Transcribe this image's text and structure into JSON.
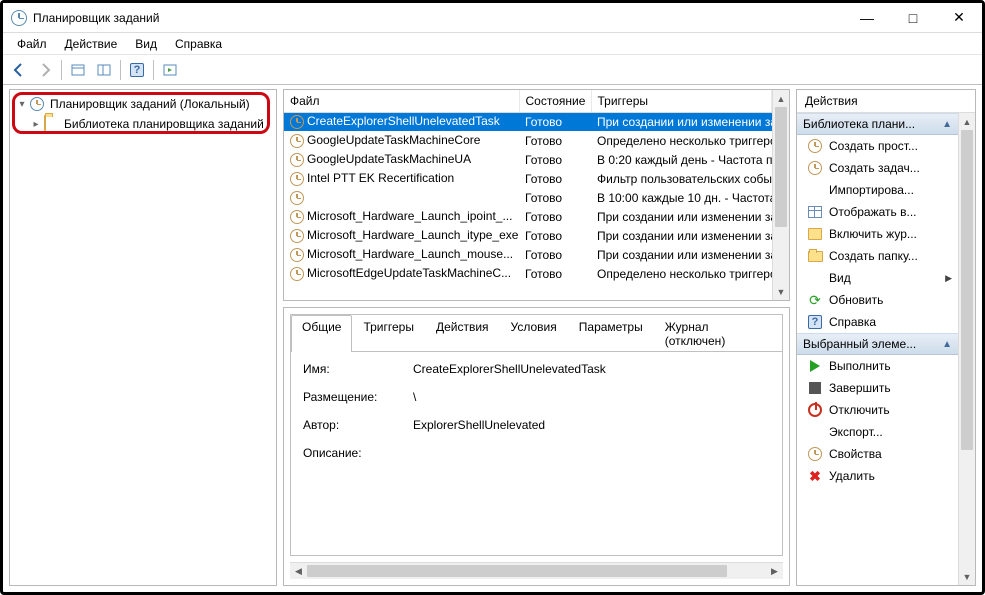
{
  "window": {
    "title": "Планировщик заданий"
  },
  "menu": {
    "file": "Файл",
    "action": "Действие",
    "view": "Вид",
    "help": "Справка"
  },
  "tree": {
    "root": "Планировщик заданий (Локальный)",
    "library": "Библиотека планировщика заданий"
  },
  "columns": {
    "name": "Файл",
    "status": "Состояние",
    "triggers": "Триггеры"
  },
  "tasks": [
    {
      "name": "CreateExplorerShellUnelevatedTask",
      "status": "Готово",
      "trigger": "При создании или изменении зад",
      "sel": true
    },
    {
      "name": "GoogleUpdateTaskMachineCore",
      "status": "Готово",
      "trigger": "Определено несколько триггеро"
    },
    {
      "name": "GoogleUpdateTaskMachineUA",
      "status": "Готово",
      "trigger": "В 0:20 каждый день - Частота пов"
    },
    {
      "name": "Intel PTT EK Recertification",
      "status": "Готово",
      "trigger": "Фильтр пользовательских событий"
    },
    {
      "name": " ",
      "status": "Готово",
      "trigger": "В 10:00 каждые 10 дн. - Частота по"
    },
    {
      "name": "Microsoft_Hardware_Launch_ipoint_...",
      "status": "Готово",
      "trigger": "При создании или изменении зад"
    },
    {
      "name": "Microsoft_Hardware_Launch_itype_exe",
      "status": "Готово",
      "trigger": "При создании или изменении зад"
    },
    {
      "name": "Microsoft_Hardware_Launch_mouse...",
      "status": "Готово",
      "trigger": "При создании или изменении зад"
    },
    {
      "name": "MicrosoftEdgeUpdateTaskMachineC...",
      "status": "Готово",
      "trigger": "Определено несколько триггеро"
    }
  ],
  "details": {
    "tabs": {
      "general": "Общие",
      "triggers": "Триггеры",
      "actions": "Действия",
      "conditions": "Условия",
      "settings": "Параметры",
      "history": "Журнал (отключен)"
    },
    "labels": {
      "name": "Имя:",
      "location": "Размещение:",
      "author": "Автор:",
      "description": "Описание:"
    },
    "values": {
      "name": "CreateExplorerShellUnelevatedTask",
      "location": "\\",
      "author": "ExplorerShellUnelevated",
      "description": ""
    }
  },
  "actions": {
    "title": "Действия",
    "group1": "Библиотека плани...",
    "items1": {
      "create_basic": "Создать прост...",
      "create": "Создать задач...",
      "import": "Импортирова...",
      "display": "Отображать в...",
      "enable_history": "Включить жур...",
      "new_folder": "Создать папку...",
      "view": "Вид",
      "refresh": "Обновить",
      "help": "Справка"
    },
    "group2": "Выбранный элеме...",
    "items2": {
      "run": "Выполнить",
      "end": "Завершить",
      "disable": "Отключить",
      "export": "Экспорт...",
      "properties": "Свойства",
      "delete": "Удалить"
    }
  }
}
